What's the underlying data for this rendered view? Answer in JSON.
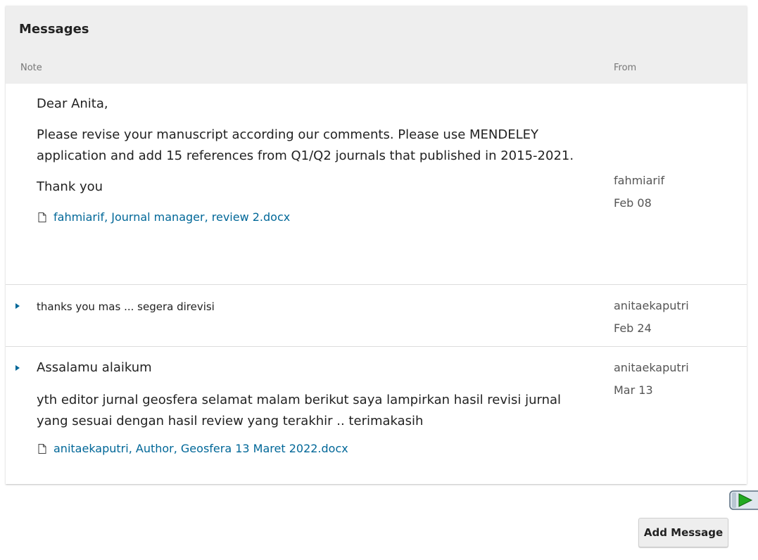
{
  "panel": {
    "title": "Messages",
    "column_note": "Note",
    "column_from": "From"
  },
  "messages": [
    {
      "collapsed": false,
      "paragraphs": [
        "Dear Anita,",
        "Please revise your manuscript according our comments. Please use MENDELEY application and add 15 references from Q1/Q2 journals that published in 2015-2021.",
        "Thank you"
      ],
      "attachment": "fahmiarif, Journal manager, review 2.docx",
      "from_user": "fahmiarif",
      "date": "Feb 08"
    },
    {
      "collapsed": true,
      "paragraphs": [
        "thanks you mas ... segera direvisi"
      ],
      "from_user": "anitaekaputri",
      "date": "Feb 24"
    },
    {
      "collapsed": true,
      "paragraphs": [
        "Assalamu alaikum",
        "yth editor jurnal geosfera selamat malam berikut saya lampirkan hasil revisi jurnal yang sesuai dengan hasil review yang terakhir .. terimakasih"
      ],
      "attachment": "anitaekaputri, Author, Geosfera 13 Maret 2022.docx",
      "from_user": "anitaekaputri",
      "date": "Mar 13"
    }
  ],
  "actions": {
    "add_message_label": "Add Message"
  },
  "icons": {
    "toggle": "triangle-right-icon",
    "file": "file-icon",
    "media_play": "play-icon"
  },
  "colors": {
    "link": "#006798",
    "header_bg": "#eeeeee",
    "play_green": "#22aa22"
  }
}
